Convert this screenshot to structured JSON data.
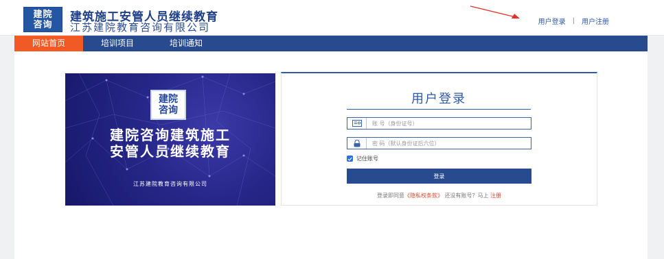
{
  "header": {
    "logo_line1": "建院",
    "logo_line2": "咨询",
    "title": "建筑施工安管人员继续教育",
    "subtitle": "江苏建院教育咨询有限公司",
    "login_link": "用户登录",
    "separator": "|",
    "register_link": "用户注册",
    "annotation_color": "#e0312b"
  },
  "nav": {
    "items": [
      {
        "label": "网站首页",
        "active": true
      },
      {
        "label": "培训项目",
        "active": false
      },
      {
        "label": "培训通知",
        "active": false
      }
    ]
  },
  "banner": {
    "logo_line1": "建院",
    "logo_line2": "咨询",
    "title_line1": "建院咨询建筑施工",
    "title_line2": "安管人员继续教育",
    "company": "江苏建院教育咨询有限公司"
  },
  "login": {
    "title": "用户登录",
    "account_placeholder": "账 号（身份证号）",
    "password_placeholder": "密 码（默认身份证后六位）",
    "remember_label": "记住账号",
    "remember_checked": true,
    "submit_label": "登录",
    "agree_prefix": "登录即同意",
    "privacy_link": "《隐私权条款》",
    "no_account_text": "还没有账号？马上",
    "register_link": "注册"
  },
  "colors": {
    "brand_blue": "#284b8f",
    "accent_orange": "#f15a24",
    "link_red": "#e04a2a"
  }
}
